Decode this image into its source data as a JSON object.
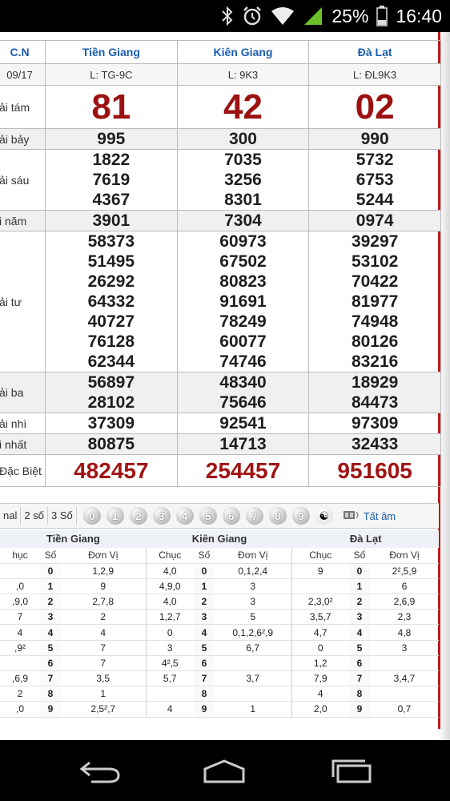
{
  "status_bar": {
    "battery": "25%",
    "time": "16:40"
  },
  "header": {
    "col0": "C.N",
    "provinces": [
      "Tiền Giang",
      "Kiên Giang",
      "Đà Lạt"
    ]
  },
  "codes": {
    "col0": "09/17",
    "values": [
      "L: TG-9C",
      "L: 9K3",
      "L: ĐL9K3"
    ]
  },
  "prizes": [
    {
      "label": "ải tám",
      "values": [
        [
          "81"
        ],
        [
          "42"
        ],
        [
          "02"
        ]
      ]
    },
    {
      "label": "ải bảy",
      "values": [
        [
          "995"
        ],
        [
          "300"
        ],
        [
          "990"
        ]
      ]
    },
    {
      "label": "ải sáu",
      "values": [
        [
          "1822",
          "7619",
          "4367"
        ],
        [
          "7035",
          "3256",
          "8301"
        ],
        [
          "5732",
          "6753",
          "5244"
        ]
      ]
    },
    {
      "label": "i năm",
      "values": [
        [
          "3901"
        ],
        [
          "7304"
        ],
        [
          "0974"
        ]
      ]
    },
    {
      "label": "ải tư",
      "values": [
        [
          "58373",
          "51495",
          "26292",
          "64332",
          "40727",
          "76128",
          "62344"
        ],
        [
          "60973",
          "67502",
          "80823",
          "91691",
          "78249",
          "60077",
          "74746"
        ],
        [
          "39297",
          "53102",
          "70422",
          "81977",
          "74948",
          "80126",
          "83216"
        ]
      ]
    },
    {
      "label": "ải ba",
      "values": [
        [
          "56897",
          "28102"
        ],
        [
          "48340",
          "75646"
        ],
        [
          "18929",
          "84473"
        ]
      ]
    },
    {
      "label": "ải nhì",
      "values": [
        [
          "37309"
        ],
        [
          "92541"
        ],
        [
          "97309"
        ]
      ]
    },
    {
      "label": "i nhất",
      "values": [
        [
          "80875"
        ],
        [
          "14713"
        ],
        [
          "32433"
        ]
      ]
    },
    {
      "label": "Đặc Biệt",
      "values": [
        [
          "482457"
        ],
        [
          "254457"
        ],
        [
          "951605"
        ]
      ]
    }
  ],
  "toolbar": {
    "tabs": [
      "nal",
      "2 số",
      "3 Số"
    ],
    "balls": [
      "0",
      "1",
      "2",
      "3",
      "4",
      "5",
      "6",
      "7",
      "8",
      "9",
      "☯"
    ],
    "all_label": "Tất âm"
  },
  "loto": {
    "groups": [
      "Tiền Giang",
      "Kiên Giang",
      "Đà Lạt"
    ],
    "headers": [
      "hục",
      "Số",
      "Đơn Vị",
      "Chục",
      "Số",
      "Đơn Vị",
      "Chục",
      "Số",
      "Đơn Vị"
    ],
    "rows": [
      [
        "",
        "0",
        "1,2,9",
        "4,0",
        "0",
        "0,1,2,4",
        "9",
        "0",
        "2²,5,9"
      ],
      [
        ",0",
        "1",
        "9",
        "4,9,0",
        "1",
        "3",
        "",
        "1",
        "6"
      ],
      [
        ",9,0",
        "2",
        "2,7,8",
        "4,0",
        "2",
        "3",
        "2,3,0²",
        "2",
        "2,6,9"
      ],
      [
        "7",
        "3",
        "2",
        "1,2,7",
        "3",
        "5",
        "3,5,7",
        "3",
        "2,3"
      ],
      [
        "4",
        "4",
        "4",
        "0",
        "4",
        "0,1,2,6²,9",
        "4,7",
        "4",
        "4,8"
      ],
      [
        ",9²",
        "5",
        "7",
        "3",
        "5",
        "6,7",
        "0",
        "5",
        "3"
      ],
      [
        "",
        "6",
        "7",
        "4²,5",
        "6",
        "",
        "1,2",
        "6",
        ""
      ],
      [
        ",6,9",
        "7",
        "3,5",
        "5,7",
        "7",
        "3,7",
        "7,9",
        "7",
        "3,4,7"
      ],
      [
        "2",
        "8",
        "1",
        "",
        "8",
        "",
        "4",
        "8",
        ""
      ],
      [
        ",0",
        "9",
        "2,5²,7",
        "4",
        "9",
        "1",
        "2,0",
        "9",
        "0,7"
      ]
    ]
  }
}
